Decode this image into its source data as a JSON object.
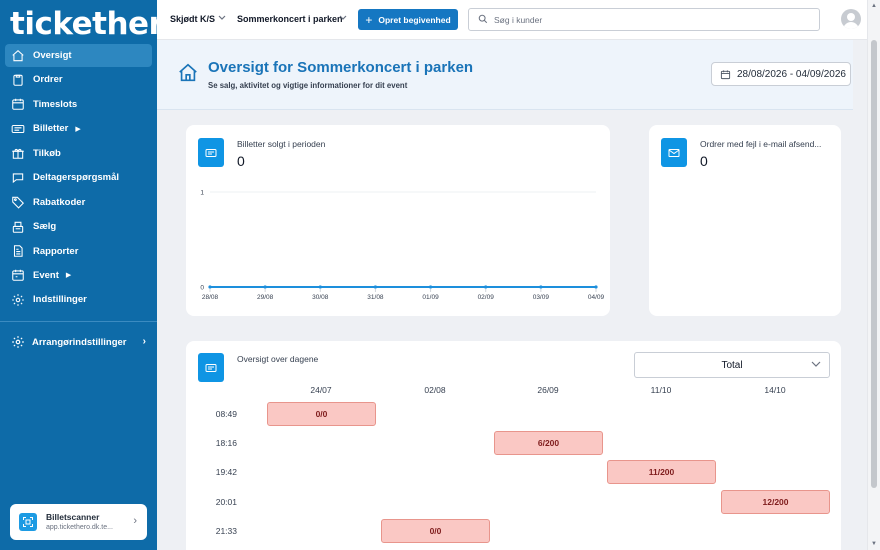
{
  "app": {
    "logo": "tickethero"
  },
  "sidebar": {
    "items": [
      {
        "label": "Oversigt",
        "icon": "home-icon",
        "active": true
      },
      {
        "label": "Ordrer",
        "icon": "clipboard-icon"
      },
      {
        "label": "Timeslots",
        "icon": "calendar-clock-icon"
      },
      {
        "label": "Billetter",
        "icon": "ticket-icon",
        "caret": "▶"
      },
      {
        "label": "Tilkøb",
        "icon": "gift-icon"
      },
      {
        "label": "Deltagerspørgsmål",
        "icon": "chat-icon"
      },
      {
        "label": "Rabatkoder",
        "icon": "tag-icon"
      },
      {
        "label": "Sælg",
        "icon": "register-icon"
      },
      {
        "label": "Rapporter",
        "icon": "report-icon"
      },
      {
        "label": "Event",
        "icon": "event-icon",
        "caret": "▶"
      },
      {
        "label": "Indstillinger",
        "icon": "gear-icon"
      }
    ],
    "org_settings": {
      "label": "Arrangørindstillinger",
      "chevron": "›"
    },
    "scanner": {
      "title": "Billetscanner",
      "subtitle": "app.tickethero.dk.te...",
      "chevron": "›"
    }
  },
  "topbar": {
    "org": "Skjødt K/S",
    "event": "Sommerkoncert i parken",
    "create_label": "Opret begivenhed",
    "search_placeholder": "Søg i kunder"
  },
  "header": {
    "title": "Oversigt for Sommerkoncert i parken",
    "subtitle": "Se salg, aktivitet og vigtige informationer for dit event",
    "date_range": "28/08/2026 - 04/09/2026"
  },
  "stats": {
    "tickets_sold": {
      "label": "Billetter solgt i perioden",
      "value": "0"
    },
    "email_errors": {
      "label": "Ordrer med fejl i e-mail afsend...",
      "value": "0"
    }
  },
  "chart_data": {
    "type": "line",
    "title": "",
    "xlabel": "",
    "ylabel": "",
    "x": [
      "28/08",
      "29/08",
      "30/08",
      "31/08",
      "01/09",
      "02/09",
      "03/09",
      "04/09"
    ],
    "series": [
      {
        "values": [
          0,
          0,
          0,
          0,
          0,
          0,
          0,
          0
        ]
      }
    ],
    "ylim": [
      0,
      1
    ],
    "yticks": [
      "0",
      "1"
    ],
    "color": "#1d8fdc",
    "grid": true
  },
  "days_overview": {
    "title": "Oversigt over dagene",
    "filter_value": "Total",
    "columns": [
      "24/07",
      "02/08",
      "26/09",
      "11/10",
      "14/10"
    ],
    "rows": [
      "08:49",
      "18:16",
      "19:42",
      "20:01",
      "21:33"
    ],
    "slots": [
      {
        "row": 0,
        "col": 0,
        "value": "0/0"
      },
      {
        "row": 1,
        "col": 2,
        "value": "6/200"
      },
      {
        "row": 2,
        "col": 3,
        "value": "11/200"
      },
      {
        "row": 3,
        "col": 4,
        "value": "12/200"
      },
      {
        "row": 4,
        "col": 1,
        "value": "0/0"
      }
    ]
  },
  "colors": {
    "sidebar": "#0e6ba8",
    "accent": "#1577c2",
    "slot_fill": "#fac8c4",
    "icon_tile": "#0f95e4"
  }
}
